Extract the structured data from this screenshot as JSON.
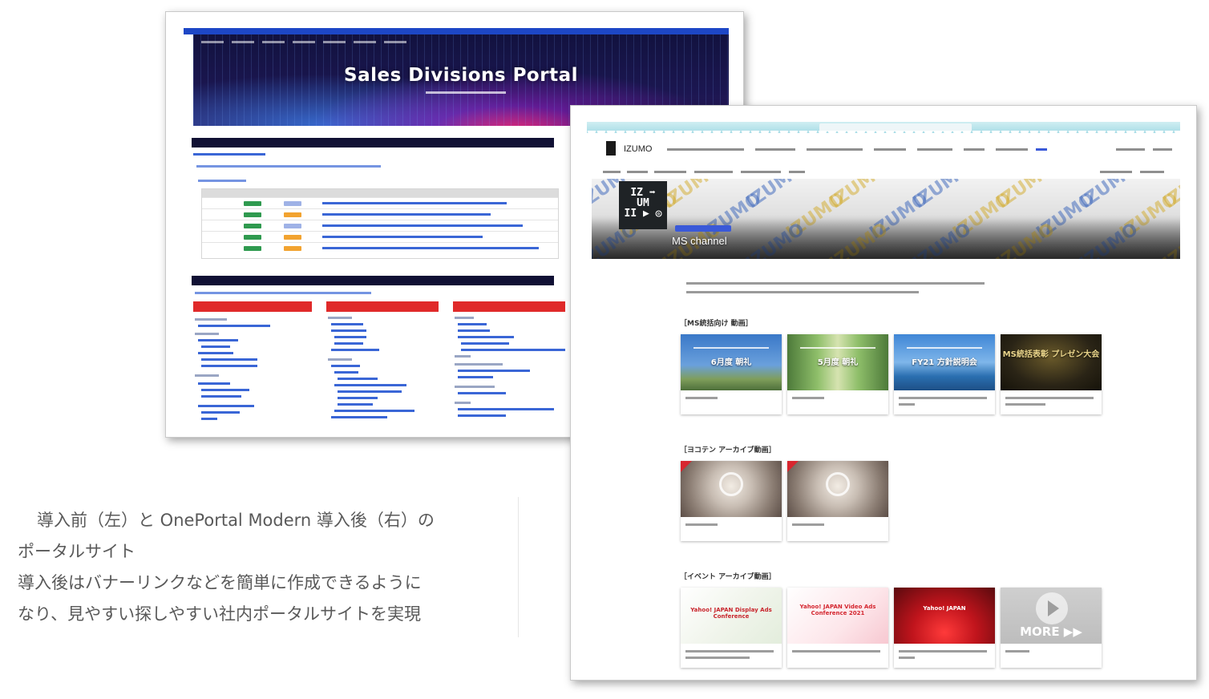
{
  "old_portal": {
    "banner_title": "Sales Divisions Portal"
  },
  "new_portal": {
    "site_name": "IZUMO",
    "logo_text": [
      "IZ ➡",
      "UM",
      "II ▶ ◎"
    ],
    "watermark_text": "IZUMO",
    "hero_title": "MS channel",
    "sections": {
      "ms_videos": {
        "heading": "［MS統括向け 動画］",
        "cards": [
          {
            "thumb_title": "6月度 朝礼",
            "theme": "sky"
          },
          {
            "thumb_title": "5月度 朝礼",
            "theme": "forest"
          },
          {
            "thumb_title": "FY21 方針説明会",
            "theme": "ocean"
          },
          {
            "thumb_title": "MS統括表彰 プレゼン大会",
            "theme": "gold"
          }
        ]
      },
      "yokoten": {
        "heading": "［ヨコテン アーカイブ動画］",
        "cards": [
          {
            "theme": "handshake"
          },
          {
            "theme": "handshake"
          }
        ]
      },
      "events": {
        "heading": "［イベント アーカイブ動画］",
        "cards": [
          {
            "thumb_title": "Yahoo! JAPAN Display Ads Conference",
            "theme": "light"
          },
          {
            "thumb_title": "Yahoo! JAPAN Video Ads Conference 2021",
            "theme": "pink"
          },
          {
            "thumb_title": "Yahoo! JAPAN",
            "theme": "red"
          },
          {
            "thumb_title": "MORE ▶▶",
            "theme": "more"
          }
        ]
      }
    }
  },
  "caption": {
    "line1": "導入前（左）と OnePortal Modern 導入後（右）の",
    "line2": "ポータルサイト",
    "line3": "導入後はバナーリンクなどを簡単に作成できるように",
    "line4": "なり、見やすい探しやすい社内ポータルサイトを実現"
  },
  "colors": {
    "old_banner": "#1b1650",
    "old_red_header": "#e02a2a",
    "new_accent": "#3a59d8",
    "caption_text": "#595959"
  }
}
